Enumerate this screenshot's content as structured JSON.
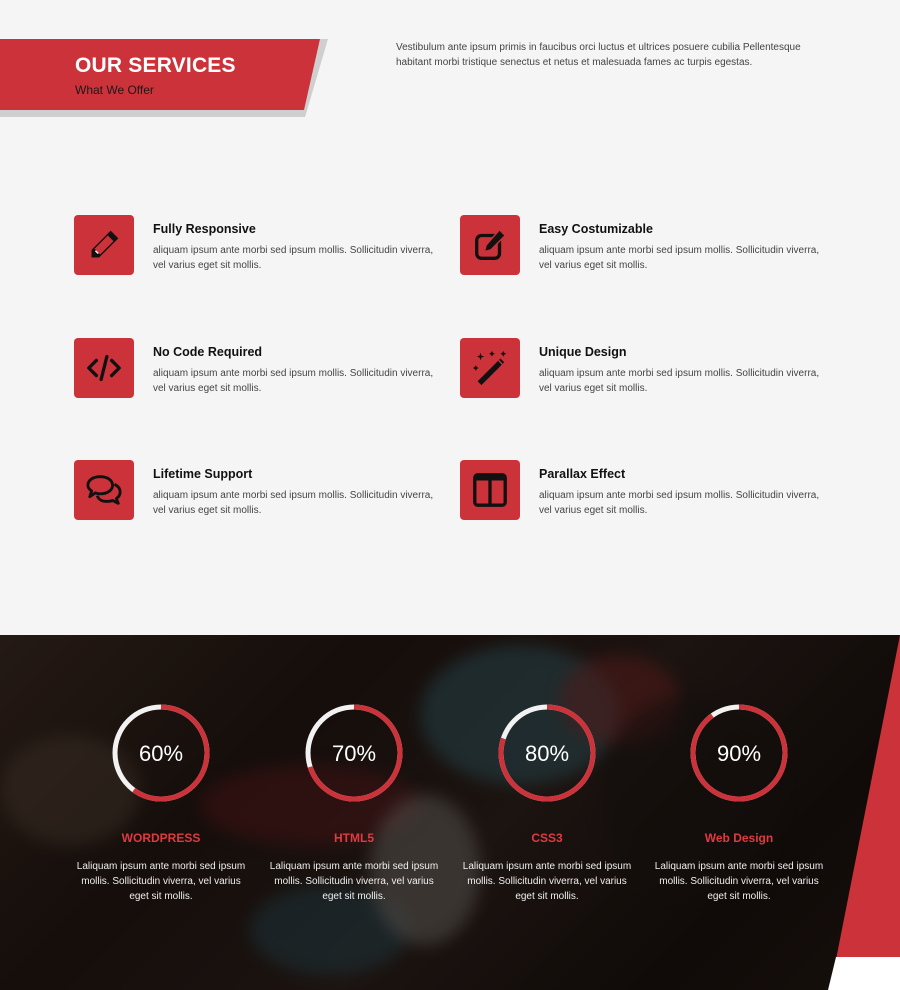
{
  "header": {
    "title": "OUR SERVICES",
    "subtitle": "What We Offer",
    "intro": "Vestibulum ante ipsum primis in faucibus orci luctus et ultrices posuere cubilia Pellentesque habitant morbi tristique senectus et netus et malesuada fames ac turpis egestas."
  },
  "features": [
    {
      "title": "Fully Responsive",
      "desc": "aliquam ipsum ante morbi sed ipsum mollis. Sollicitudin viverra, vel varius eget sit mollis.",
      "icon": "pencil-icon"
    },
    {
      "title": "Easy Costumizable",
      "desc": "aliquam ipsum ante morbi sed ipsum mollis. Sollicitudin viverra, vel varius eget sit mollis.",
      "icon": "edit-icon"
    },
    {
      "title": "No Code Required",
      "desc": "aliquam ipsum ante morbi sed ipsum mollis. Sollicitudin viverra, vel varius eget sit mollis.",
      "icon": "code-icon"
    },
    {
      "title": "Unique Design",
      "desc": "aliquam ipsum ante morbi sed ipsum mollis. Sollicitudin viverra, vel varius eget sit mollis.",
      "icon": "magic-wand-icon"
    },
    {
      "title": "Lifetime Support",
      "desc": "aliquam ipsum ante morbi sed ipsum mollis. Sollicitudin viverra, vel varius eget sit mollis.",
      "icon": "chat-bubbles-icon"
    },
    {
      "title": "Parallax Effect",
      "desc": "aliquam ipsum ante morbi sed ipsum mollis. Sollicitudin viverra, vel varius eget sit mollis.",
      "icon": "columns-icon"
    }
  ],
  "skills": [
    {
      "name": "WORDPRESS",
      "percent": 60,
      "label": "60%",
      "desc": "Laliquam ipsum ante morbi sed ipsum mollis. Sollicitudin viverra, vel varius eget sit mollis."
    },
    {
      "name": "HTML5",
      "percent": 70,
      "label": "70%",
      "desc": "Laliquam ipsum ante morbi sed ipsum mollis. Sollicitudin viverra, vel varius eget sit mollis."
    },
    {
      "name": "CSS3",
      "percent": 80,
      "label": "80%",
      "desc": "Laliquam ipsum ante morbi sed ipsum mollis. Sollicitudin viverra, vel varius eget sit mollis."
    },
    {
      "name": "Web Design",
      "percent": 90,
      "label": "90%",
      "desc": "Laliquam ipsum ante morbi sed ipsum mollis. Sollicitudin viverra, vel varius eget sit mollis."
    }
  ],
  "colors": {
    "accent": "#cc3239",
    "ring_track": "#f2f2f2",
    "ring_fill": "#cc3239"
  }
}
